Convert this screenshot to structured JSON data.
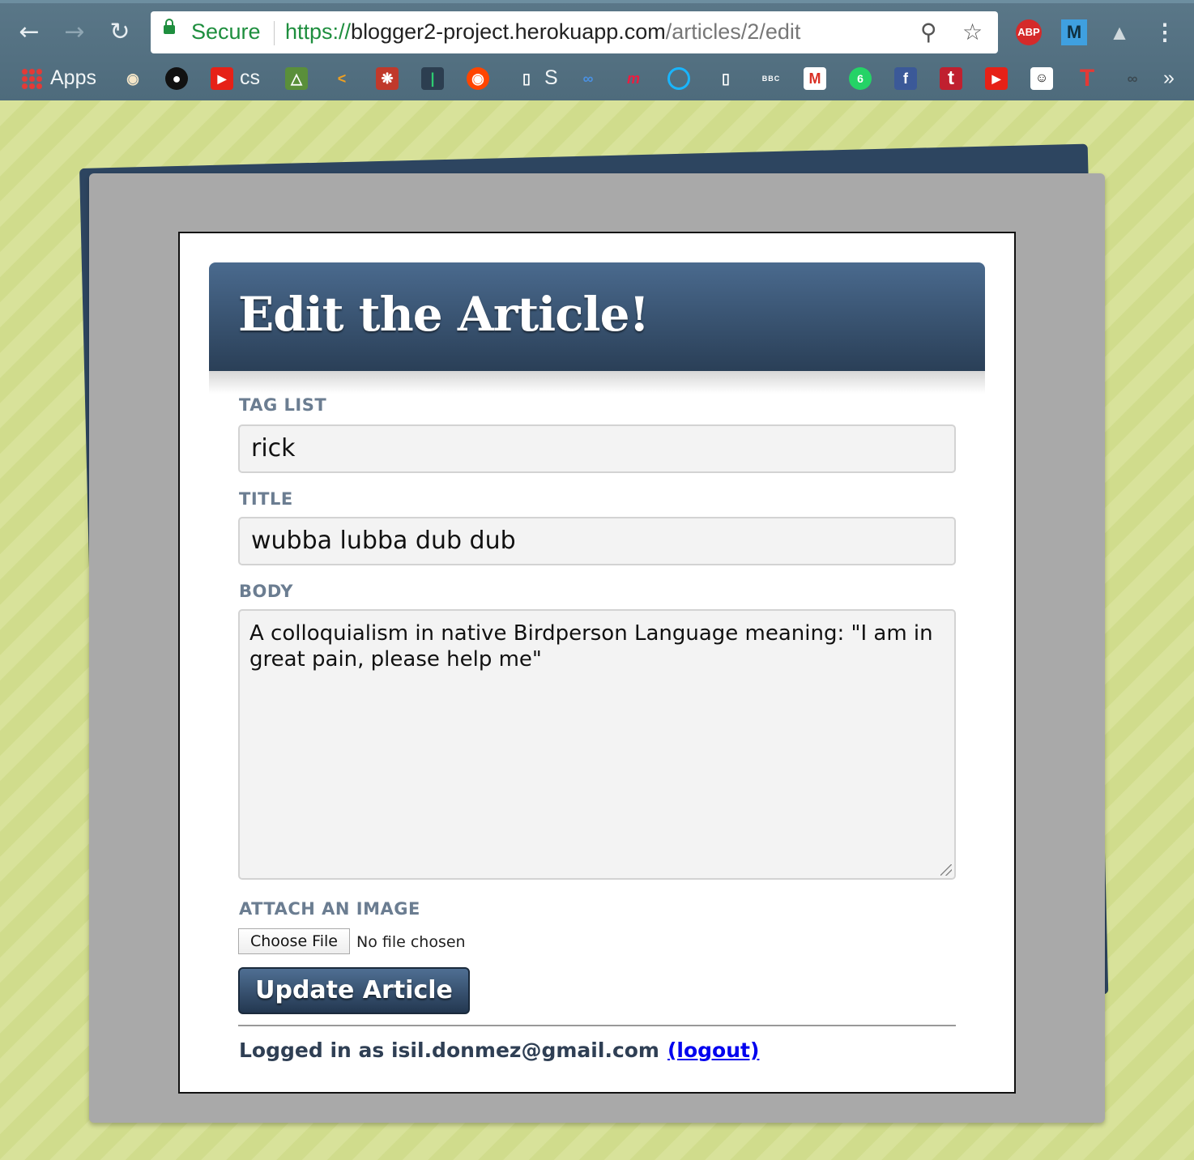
{
  "browser": {
    "secure_label": "Secure",
    "url_scheme": "https://",
    "url_host": "blogger2-project.herokuapp.com",
    "url_path": "/articles/2/edit",
    "extensions": {
      "abp": "ABP",
      "m": "M"
    },
    "bookmarks": {
      "apps": "Apps",
      "cs": "cs",
      "s": "S",
      "bbc": "BBC",
      "overflow": "»"
    }
  },
  "page": {
    "title": "Edit the Article!",
    "tag_list": {
      "label": "TAG LIST",
      "value": "rick"
    },
    "title_field": {
      "label": "TITLE",
      "value": "wubba lubba dub dub"
    },
    "body_field": {
      "label": "BODY",
      "value": "A colloquialism in native Birdperson Language meaning: \"I am in great pain, please help me\""
    },
    "image": {
      "label": "ATTACH AN IMAGE",
      "button": "Choose File",
      "status": "No file chosen"
    },
    "submit_label": "Update Article",
    "footer": {
      "logged_in_text": "Logged in as isil.donmez@gmail.com",
      "logout_link": "(logout)"
    }
  },
  "colors": {
    "header_top": "#4a6a8e",
    "header_bottom": "#2a3f57",
    "label": "#6b7d91",
    "background": "#d8e29a",
    "link": "#0000ee"
  }
}
